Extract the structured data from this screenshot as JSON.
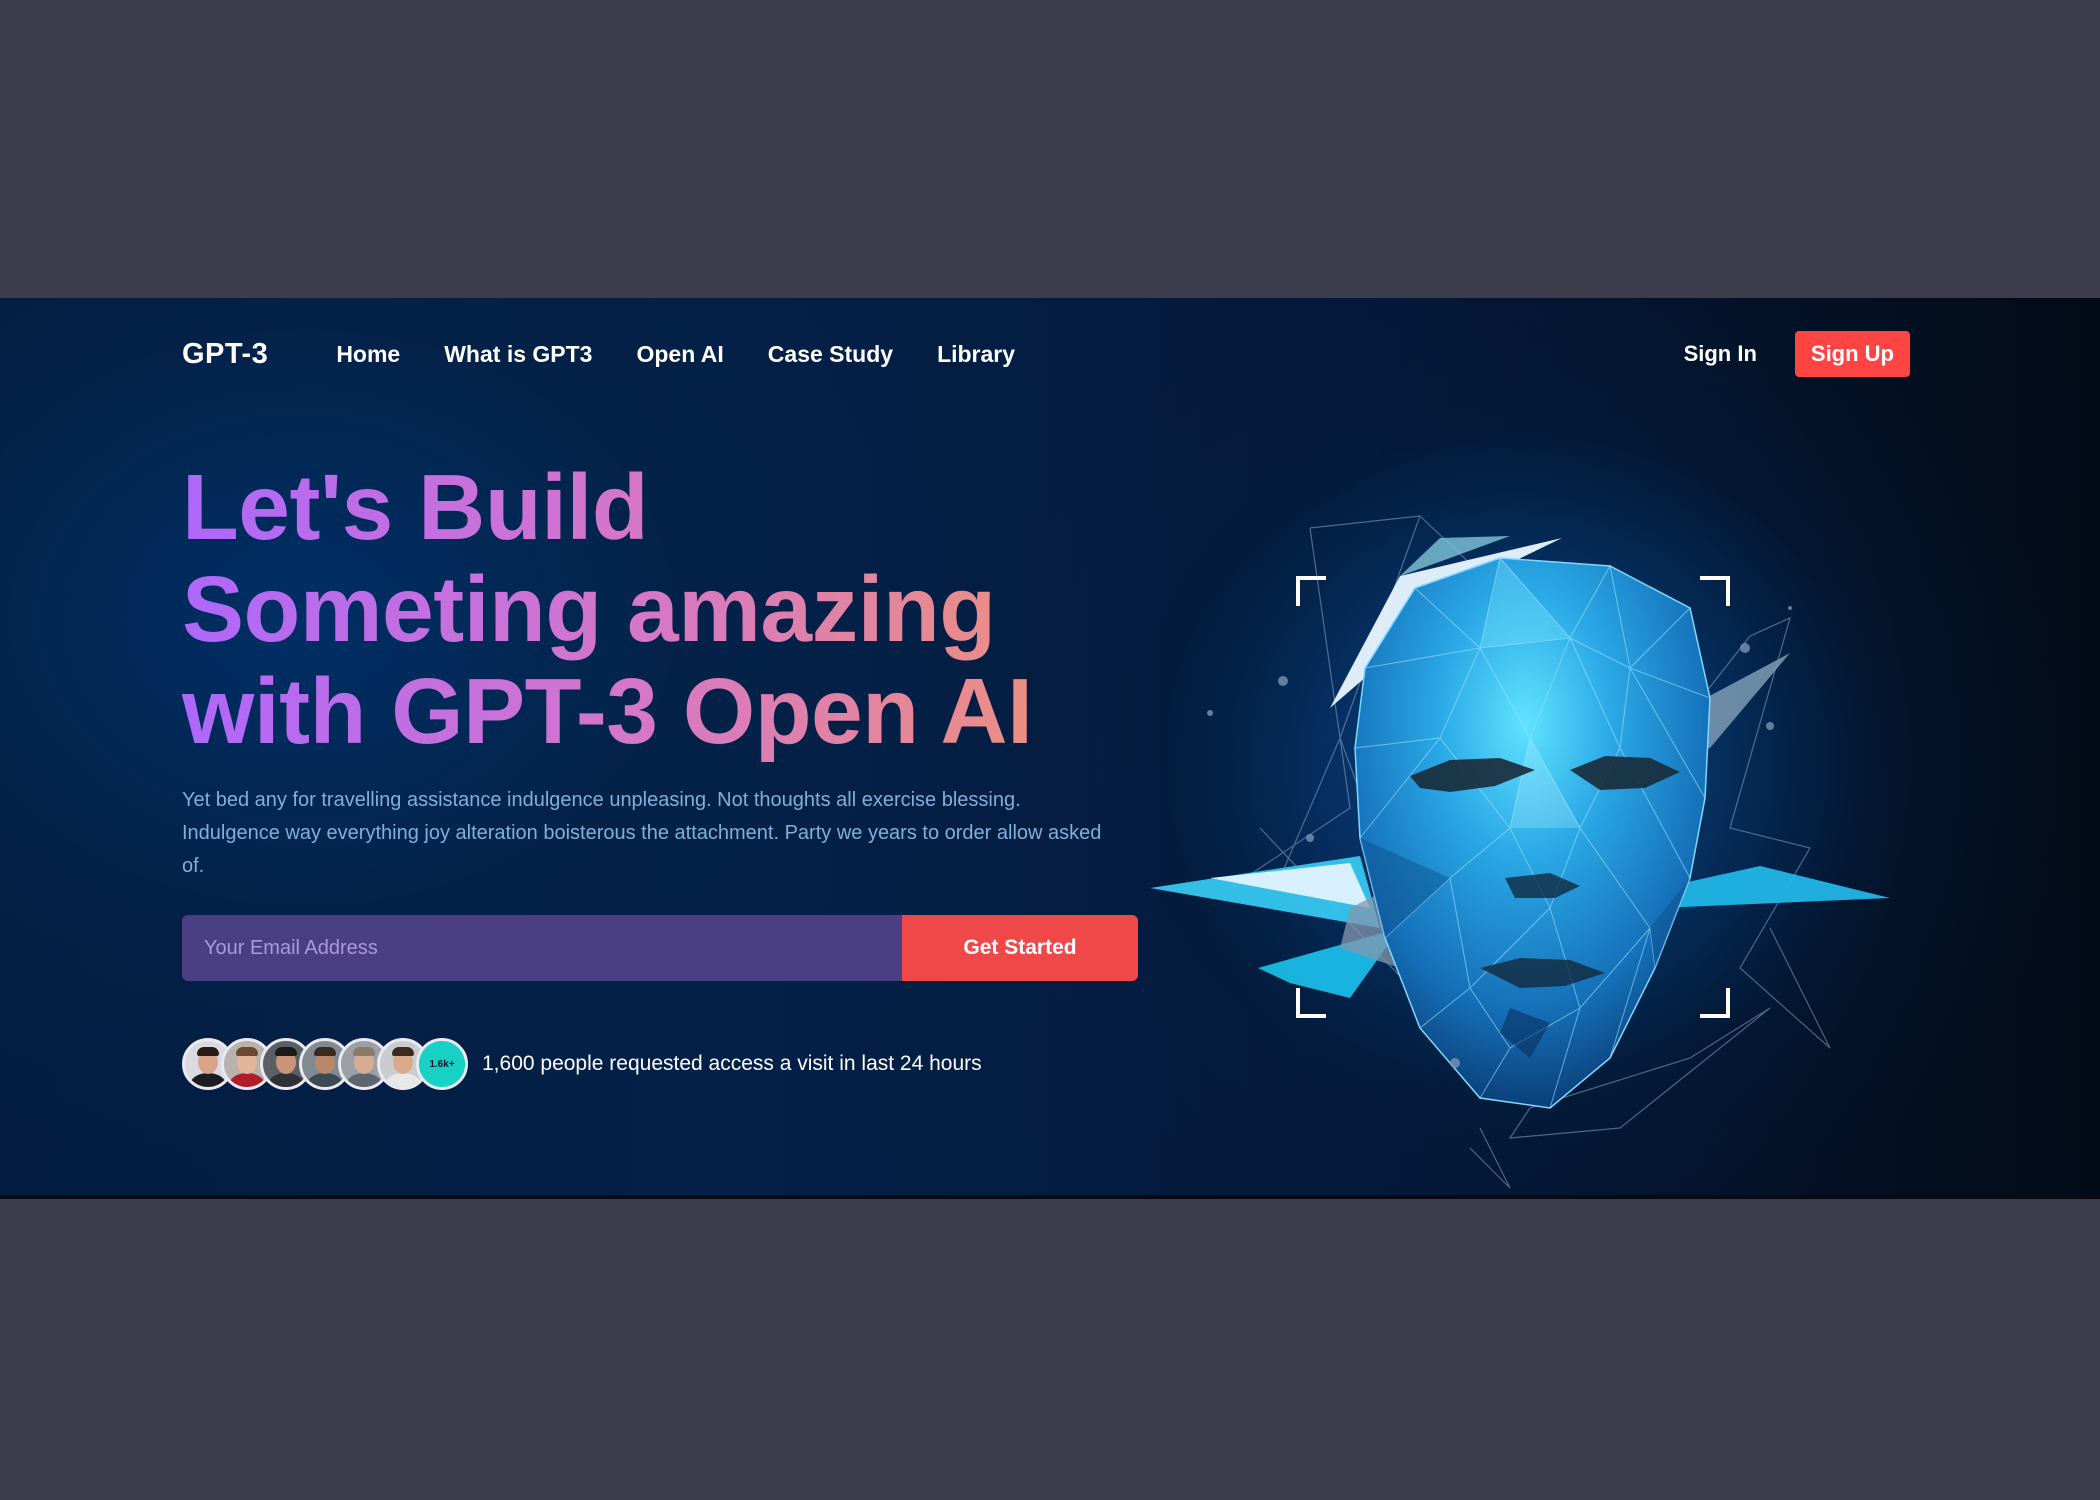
{
  "nav": {
    "logo": "GPT-3",
    "links": [
      "Home",
      "What is GPT3",
      "Open AI",
      "Case Study",
      "Library"
    ],
    "signin": "Sign In",
    "signup": "Sign Up"
  },
  "hero": {
    "headline": [
      "Let's Build",
      "Someting amazing",
      "with GPT-3 Open AI"
    ],
    "description": "Yet bed any for travelling assistance indulgence unpleasing. Not thoughts all exercise blessing. Indulgence way everything joy alteration boisterous the attachment. Party we years to order allow asked of.",
    "email_placeholder": "Your Email Address",
    "cta": "Get Started",
    "badge": "1.6k+",
    "people_text": "1,600 people requested access a visit in last 24 hours"
  },
  "colors": {
    "gradient": [
      "#ae67fa",
      "#f49867"
    ],
    "cta": "#f04848",
    "input": "#4a3f83",
    "badge": "#17d1c5"
  },
  "icons": [
    "ai-face-illustration"
  ]
}
